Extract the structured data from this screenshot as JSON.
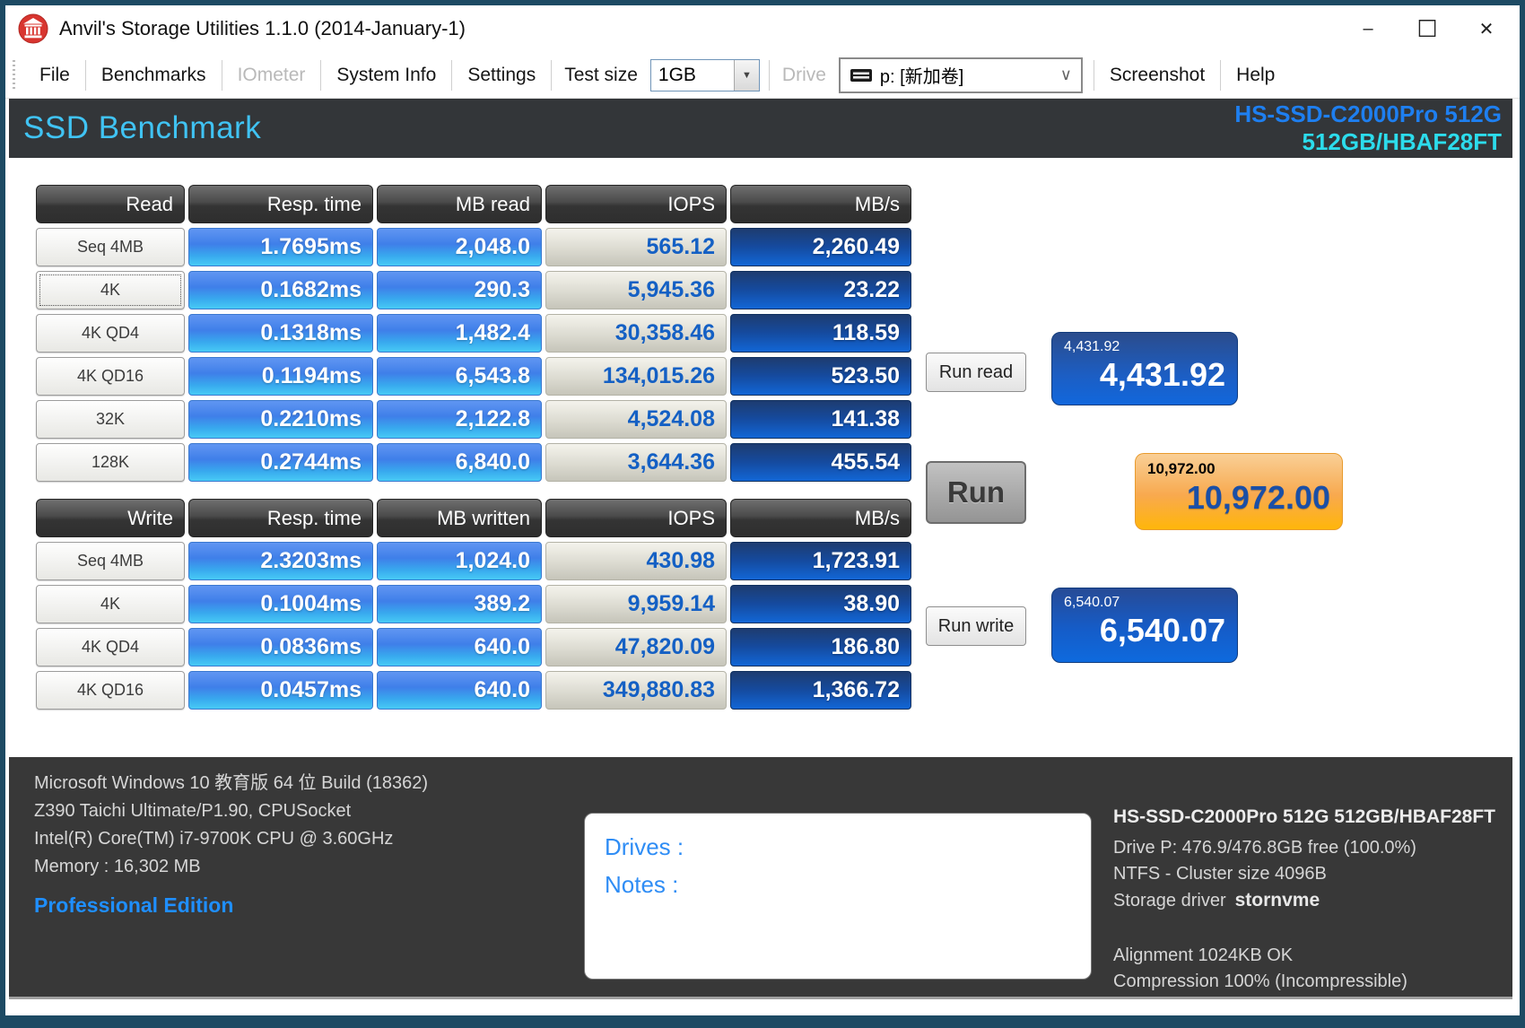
{
  "window": {
    "title": "Anvil's Storage Utilities 1.1.0 (2014-January-1)",
    "controls": {
      "minimize": "–",
      "maximize": "☐",
      "close": "✕"
    }
  },
  "menu": {
    "file": "File",
    "benchmarks": "Benchmarks",
    "iometer": "IOmeter",
    "system_info": "System Info",
    "settings": "Settings",
    "test_size_label": "Test size",
    "test_size_value": "1GB",
    "drive_label": "Drive",
    "drive_value": "p: [新加卷]",
    "screenshot": "Screenshot",
    "help": "Help"
  },
  "header": {
    "title": "SSD Benchmark",
    "device_line1": "HS-SSD-C2000Pro 512G",
    "device_line2": "512GB/HBAF28FT"
  },
  "read_table": {
    "headers": [
      "Read",
      "Resp. time",
      "MB read",
      "IOPS",
      "MB/s"
    ],
    "rows": [
      {
        "label": "Seq 4MB",
        "resp": "1.7695ms",
        "mb": "2,048.0",
        "iops": "565.12",
        "mbs": "2,260.49",
        "focused": false
      },
      {
        "label": "4K",
        "resp": "0.1682ms",
        "mb": "290.3",
        "iops": "5,945.36",
        "mbs": "23.22",
        "focused": true
      },
      {
        "label": "4K QD4",
        "resp": "0.1318ms",
        "mb": "1,482.4",
        "iops": "30,358.46",
        "mbs": "118.59",
        "focused": false
      },
      {
        "label": "4K QD16",
        "resp": "0.1194ms",
        "mb": "6,543.8",
        "iops": "134,015.26",
        "mbs": "523.50",
        "focused": false
      },
      {
        "label": "32K",
        "resp": "0.2210ms",
        "mb": "2,122.8",
        "iops": "4,524.08",
        "mbs": "141.38",
        "focused": false
      },
      {
        "label": "128K",
        "resp": "0.2744ms",
        "mb": "6,840.0",
        "iops": "3,644.36",
        "mbs": "455.54",
        "focused": false
      }
    ]
  },
  "write_table": {
    "headers": [
      "Write",
      "Resp. time",
      "MB written",
      "IOPS",
      "MB/s"
    ],
    "rows": [
      {
        "label": "Seq 4MB",
        "resp": "2.3203ms",
        "mb": "1,024.0",
        "iops": "430.98",
        "mbs": "1,723.91",
        "focused": false
      },
      {
        "label": "4K",
        "resp": "0.1004ms",
        "mb": "389.2",
        "iops": "9,959.14",
        "mbs": "38.90",
        "focused": false
      },
      {
        "label": "4K QD4",
        "resp": "0.0836ms",
        "mb": "640.0",
        "iops": "47,820.09",
        "mbs": "186.80",
        "focused": false
      },
      {
        "label": "4K QD16",
        "resp": "0.0457ms",
        "mb": "640.0",
        "iops": "349,880.83",
        "mbs": "1,366.72",
        "focused": false
      }
    ]
  },
  "actions": {
    "run_read": "Run read",
    "run": "Run",
    "run_write": "Run write"
  },
  "scores": {
    "read": {
      "small": "4,431.92",
      "large": "4,431.92"
    },
    "total": {
      "small": "10,972.00",
      "large": "10,972.00"
    },
    "write": {
      "small": "6,540.07",
      "large": "6,540.07"
    }
  },
  "footer": {
    "os_line": "Microsoft Windows 10 教育版 64 位 Build (18362)",
    "board_line": "Z390 Taichi Ultimate/P1.90, CPUSocket",
    "cpu_line": "Intel(R) Core(TM) i7-9700K CPU @ 3.60GHz",
    "memory_line": "Memory : 16,302 MB",
    "edition": "Professional Edition",
    "drives_label": "Drives :",
    "notes_label": "Notes :",
    "device_title": "HS-SSD-C2000Pro 512G 512GB/HBAF28FT",
    "drive_line": "Drive P: 476.9/476.8GB free (100.0%)",
    "fs_line": "NTFS - Cluster size 4096B",
    "storage_driver_label": "Storage driver",
    "storage_driver_value": "stornvme",
    "alignment_line": "Alignment 1024KB OK",
    "compression_line": "Compression 100% (Incompressible)"
  },
  "colors": {
    "accent_cyan": "#40c3f3",
    "device_blue": "#1e7ff0",
    "device_cyan": "#2cdcec",
    "score_blue": "#1167dc",
    "score_orange": "#ffb60a",
    "window_border": "#1d4a63"
  }
}
